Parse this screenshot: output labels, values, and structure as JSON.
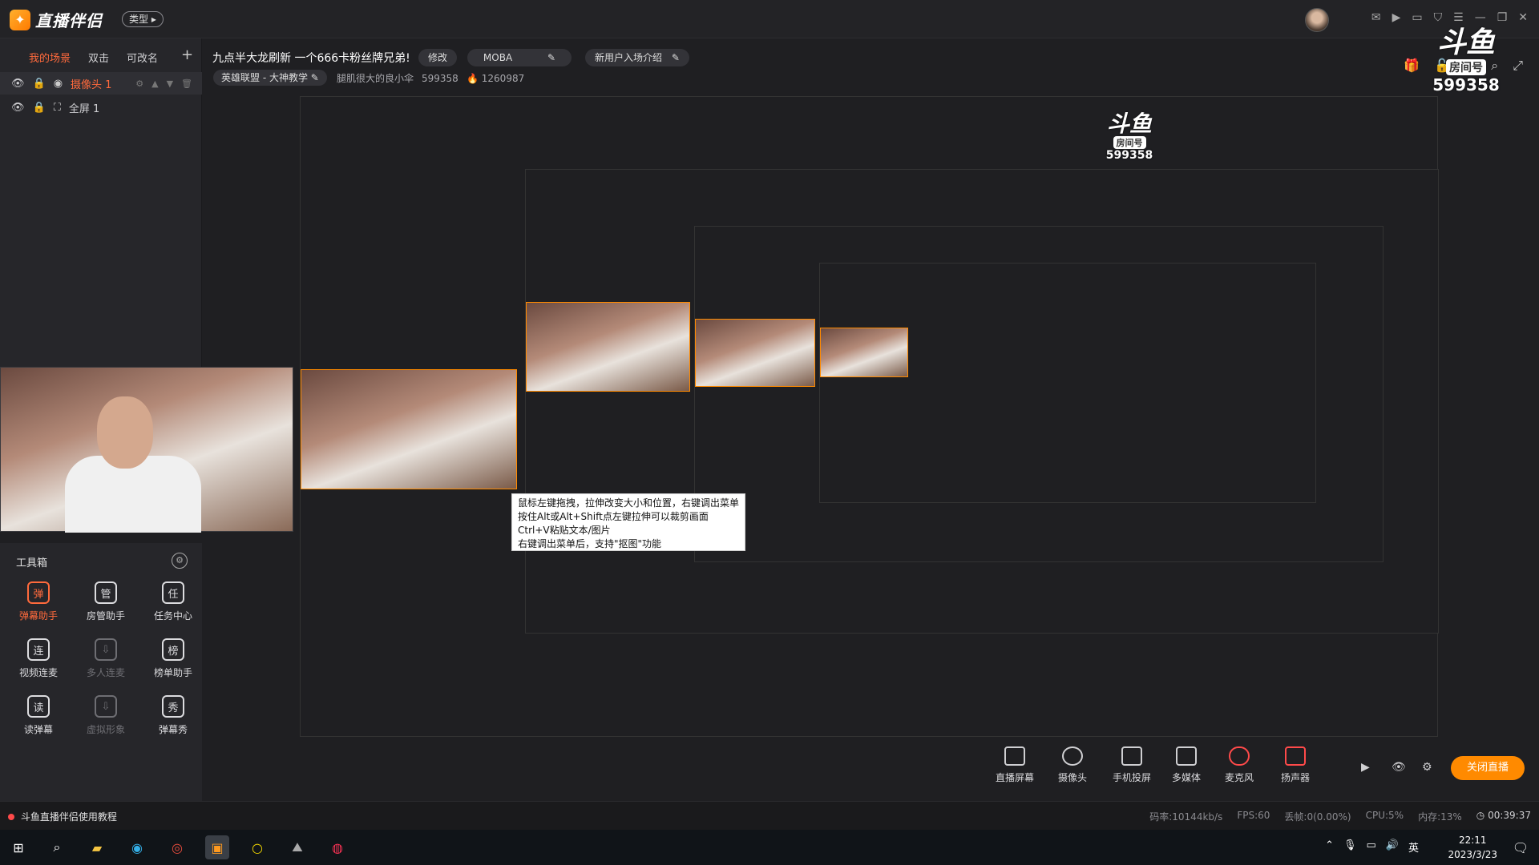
{
  "app": {
    "logo_text": "直播伴侣",
    "type_label": "类型 ▸"
  },
  "scene_tabs": [
    {
      "label": "我的场景",
      "active": true
    },
    {
      "label": "双击",
      "active": false
    },
    {
      "label": "可改名",
      "active": false
    }
  ],
  "add_scene_label": "+",
  "sources": [
    {
      "label": "摄像头 1",
      "selected": true
    },
    {
      "label": "全屏 1",
      "selected": false
    }
  ],
  "stream": {
    "title": "九点半大龙刷新 一个666卡粉丝牌兄弟!",
    "edit_label": "修改",
    "category_pill": "MOBA",
    "notice_pill": "新用户入场介绍",
    "game_label": "英雄联盟 - 大神教学",
    "host_name": "腿肌很大的良小伞",
    "room_id": "599358",
    "heat": "1260987"
  },
  "watermark": {
    "big": "斗鱼",
    "tag": "房间号",
    "number": "599358"
  },
  "toolbox": {
    "title": "工具箱",
    "settings_icon": "⚙",
    "tools": [
      {
        "label": "弹幕助手",
        "icon": "弹",
        "state": "red"
      },
      {
        "label": "房管助手",
        "icon": "管",
        "state": "normal"
      },
      {
        "label": "任务中心",
        "icon": "任",
        "state": "normal"
      },
      {
        "label": "视频连麦",
        "icon": "连",
        "state": "normal"
      },
      {
        "label": "多人连麦",
        "icon": "⇩",
        "state": "dim"
      },
      {
        "label": "榜单助手",
        "icon": "榜",
        "state": "normal"
      },
      {
        "label": "读弹幕",
        "icon": "读",
        "state": "normal"
      },
      {
        "label": "虚拟形象",
        "icon": "⇩",
        "state": "dim"
      },
      {
        "label": "弹幕秀",
        "icon": "秀",
        "state": "normal"
      }
    ]
  },
  "tooltip": {
    "line1": "鼠标左键拖拽，拉伸改变大小和位置，右键调出菜单",
    "line2": "按住Alt或Alt+Shift点左键拉伸可以裁剪画面",
    "line3": "Ctrl+V粘贴文本/图片",
    "line4": "右键调出菜单后，支持\"抠图\"功能"
  },
  "bottom_tools": [
    {
      "label": "直播屏幕"
    },
    {
      "label": "摄像头"
    },
    {
      "label": "手机投屏"
    },
    {
      "label": "多媒体"
    },
    {
      "label": "麦克风"
    },
    {
      "label": "扬声器"
    }
  ],
  "close_live_label": "关闭直播",
  "status": {
    "tutorial": "斗鱼直播伴侣使用教程",
    "bitrate": "码率:10144kb/s",
    "fps": "FPS:60",
    "drop": "丢帧:0(0.00%)",
    "cpu": "CPU:5%",
    "mem": "内存:13%",
    "duration": "00:39:37"
  },
  "taskbar": {
    "time": "22:11",
    "date": "2023/3/23",
    "ime": "英"
  },
  "colors": {
    "accent": "#ff8a00",
    "active_text": "#ff6a3c",
    "background": "#1f1f22"
  }
}
